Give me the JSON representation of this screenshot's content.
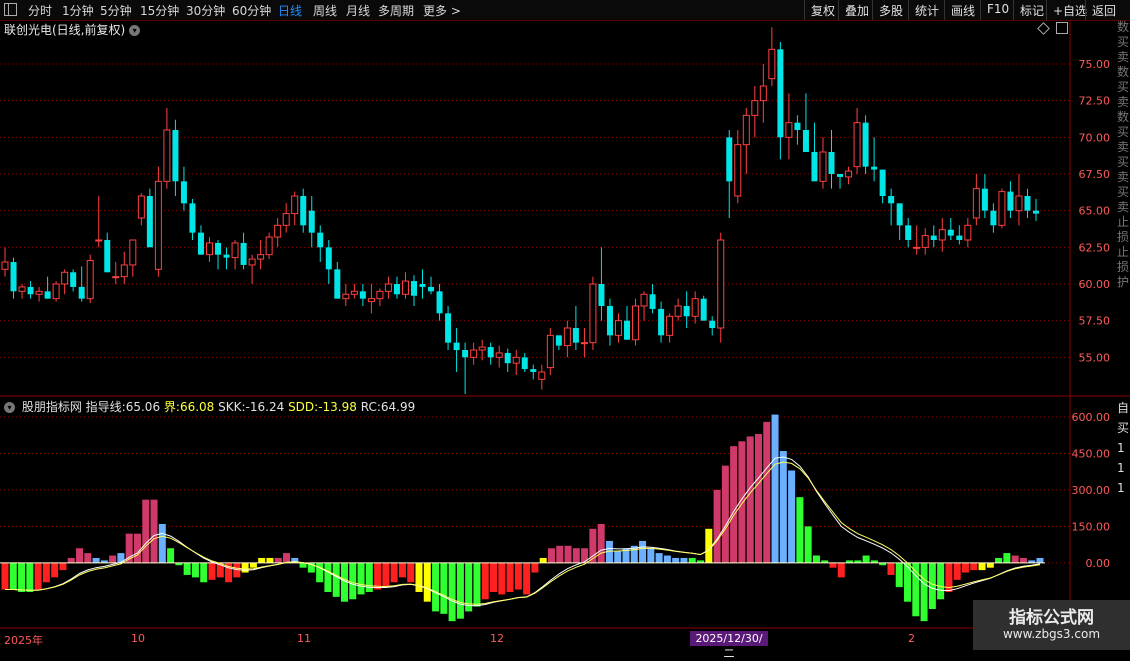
{
  "toolbar": {
    "periods": [
      {
        "label": "分时"
      },
      {
        "label": "1分钟"
      },
      {
        "label": "5分钟"
      },
      {
        "label": "15分钟"
      },
      {
        "label": "30分钟"
      },
      {
        "label": "60分钟"
      },
      {
        "label": "日线",
        "active": true
      },
      {
        "label": "周线"
      },
      {
        "label": "月线"
      },
      {
        "label": "多周期"
      },
      {
        "label": "更多 >"
      }
    ],
    "right": [
      {
        "label": "复权"
      },
      {
        "label": "叠加"
      },
      {
        "label": "多股"
      },
      {
        "label": "统计"
      },
      {
        "label": "画线"
      },
      {
        "label": "F10"
      },
      {
        "label": "标记"
      },
      {
        "label": "+自选"
      },
      {
        "label": "返回"
      }
    ]
  },
  "chart_title": "联创光电(日线,前复权)",
  "indicator": {
    "name": "股朋指标网",
    "guide_label": "指导线:",
    "guide_value": "65.06",
    "bound_label": "界:",
    "bound_value": "66.08",
    "skk_label": "SKK:",
    "skk_value": "-16.24",
    "sdd_label": "SDD:",
    "sdd_value": "-13.98",
    "rc_label": "RC:",
    "rc_value": "64.99"
  },
  "right_strip_top": "数买卖数买卖数买卖买卖买卖止损止损护",
  "right_strip_bottom": "自买111",
  "dates": {
    "labels": [
      {
        "text": "2025年"
      },
      {
        "text": "10"
      },
      {
        "text": "11"
      },
      {
        "text": "12"
      },
      {
        "text": "2"
      }
    ],
    "cursor": "2025/12/30/二"
  },
  "watermark": {
    "line1": "指标公式网",
    "line2": "www.zbgs3.com"
  },
  "colors": {
    "up": "#ff4040",
    "down": "#00e5e5",
    "grid": "#8b0000",
    "axis": "#ff5a5a"
  },
  "chart_data": [
    {
      "type": "candlestick",
      "title": "联创光电(日线,前复权)",
      "y_ticks": [
        55.0,
        57.5,
        60.0,
        62.5,
        65.0,
        67.5,
        70.0,
        72.5,
        75.0
      ],
      "ylim": [
        52.5,
        78
      ],
      "candles": [
        [
          61.0,
          62.5,
          60.5,
          61.5
        ],
        [
          61.5,
          61.8,
          59.0,
          59.5
        ],
        [
          59.5,
          60.0,
          59.0,
          59.8
        ],
        [
          59.8,
          60.2,
          59.0,
          59.3
        ],
        [
          59.3,
          59.8,
          58.8,
          59.5
        ],
        [
          59.5,
          60.5,
          59.0,
          59.0
        ],
        [
          59.0,
          60.2,
          58.8,
          60.0
        ],
        [
          60.0,
          61.0,
          59.3,
          60.8
        ],
        [
          60.8,
          61.0,
          59.5,
          59.8
        ],
        [
          59.8,
          61.2,
          58.8,
          59.0
        ],
        [
          59.0,
          62.0,
          58.7,
          61.6
        ],
        [
          63.0,
          66.0,
          62.5,
          63.0
        ],
        [
          63.0,
          63.5,
          60.8,
          60.8
        ],
        [
          60.5,
          61.5,
          60.0,
          60.5
        ],
        [
          60.5,
          62.2,
          60.0,
          61.3
        ],
        [
          61.3,
          63.0,
          60.5,
          63.0
        ],
        [
          64.5,
          66.2,
          64.0,
          66.0
        ],
        [
          66.0,
          66.5,
          63.0,
          62.5
        ],
        [
          61.0,
          68.0,
          60.5,
          67.0
        ],
        [
          67.0,
          72.0,
          66.5,
          70.5
        ],
        [
          70.5,
          71.2,
          66.0,
          67.0
        ],
        [
          67.0,
          68.0,
          65.0,
          65.5
        ],
        [
          65.5,
          65.8,
          63.0,
          63.5
        ],
        [
          63.5,
          64.0,
          62.0,
          62.0
        ],
        [
          62.0,
          63.2,
          61.5,
          62.8
        ],
        [
          62.8,
          63.0,
          61.0,
          62.0
        ],
        [
          62.0,
          62.5,
          61.0,
          61.8
        ],
        [
          61.8,
          63.0,
          61.0,
          62.8
        ],
        [
          62.8,
          63.5,
          61.0,
          61.3
        ],
        [
          61.3,
          62.0,
          60.0,
          61.7
        ],
        [
          61.7,
          63.0,
          61.0,
          62.0
        ],
        [
          62.0,
          63.5,
          61.7,
          63.2
        ],
        [
          63.2,
          64.5,
          62.5,
          64.0
        ],
        [
          64.0,
          65.5,
          63.5,
          64.8
        ],
        [
          64.8,
          66.3,
          64.0,
          66.0
        ],
        [
          66.0,
          66.5,
          63.5,
          64.0
        ],
        [
          65.0,
          66.0,
          62.5,
          63.5
        ],
        [
          63.5,
          64.0,
          61.5,
          62.5
        ],
        [
          62.5,
          63.0,
          60.0,
          61.0
        ],
        [
          61.0,
          61.5,
          59.0,
          59.0
        ],
        [
          59.0,
          60.0,
          58.5,
          59.3
        ],
        [
          59.3,
          60.0,
          59.0,
          59.5
        ],
        [
          59.5,
          60.0,
          58.5,
          59.0
        ],
        [
          58.8,
          60.0,
          58.0,
          59.0
        ],
        [
          59.0,
          59.7,
          58.5,
          59.5
        ],
        [
          59.5,
          60.5,
          59.0,
          60.0
        ],
        [
          60.0,
          60.5,
          59.0,
          59.3
        ],
        [
          59.3,
          60.8,
          59.0,
          60.2
        ],
        [
          60.2,
          60.6,
          58.5,
          59.2
        ],
        [
          60.0,
          61.0,
          59.0,
          59.8
        ],
        [
          59.8,
          60.5,
          59.3,
          59.5
        ],
        [
          59.5,
          60.0,
          57.5,
          58.0
        ],
        [
          58.0,
          58.5,
          55.5,
          56.0
        ],
        [
          56.0,
          57.0,
          54.0,
          55.5
        ],
        [
          55.5,
          56.0,
          52.5,
          55.0
        ],
        [
          55.0,
          56.0,
          54.5,
          55.5
        ],
        [
          55.5,
          56.2,
          54.8,
          55.7
        ],
        [
          55.7,
          56.0,
          54.5,
          55.0
        ],
        [
          55.0,
          55.8,
          54.3,
          55.3
        ],
        [
          55.3,
          55.6,
          54.0,
          54.6
        ],
        [
          54.6,
          55.5,
          53.8,
          55.0
        ],
        [
          55.0,
          55.3,
          54.0,
          54.2
        ],
        [
          54.2,
          54.5,
          53.5,
          54.0
        ],
        [
          53.5,
          54.5,
          52.8,
          54.0
        ],
        [
          54.3,
          57.0,
          53.8,
          56.5
        ],
        [
          56.5,
          56.5,
          55.5,
          55.8
        ],
        [
          55.8,
          57.5,
          55.0,
          57.0
        ],
        [
          57.0,
          58.5,
          55.5,
          56.0
        ],
        [
          56.0,
          57.0,
          55.0,
          56.0
        ],
        [
          56.0,
          60.5,
          55.5,
          60.0
        ],
        [
          60.0,
          62.5,
          57.5,
          58.5
        ],
        [
          58.5,
          59.0,
          55.8,
          56.5
        ],
        [
          56.5,
          58.0,
          56.0,
          57.5
        ],
        [
          57.5,
          58.5,
          56.2,
          56.2
        ],
        [
          56.2,
          59.0,
          55.8,
          58.5
        ],
        [
          58.5,
          59.5,
          57.5,
          59.3
        ],
        [
          59.3,
          60.0,
          58.0,
          58.3
        ],
        [
          58.3,
          58.8,
          56.0,
          56.5
        ],
        [
          56.5,
          58.0,
          56.0,
          57.8
        ],
        [
          57.8,
          59.0,
          57.5,
          58.5
        ],
        [
          58.5,
          59.5,
          57.0,
          57.8
        ],
        [
          57.8,
          59.5,
          57.3,
          59.0
        ],
        [
          59.0,
          59.2,
          57.5,
          57.5
        ],
        [
          57.5,
          57.8,
          56.5,
          57.0
        ],
        [
          57.0,
          63.5,
          56.0,
          63.0
        ],
        [
          70.0,
          70.5,
          64.5,
          67.0
        ],
        [
          66.0,
          70.5,
          65.5,
          69.5
        ],
        [
          69.5,
          72.0,
          67.5,
          71.5
        ],
        [
          71.5,
          73.5,
          70.0,
          72.5
        ],
        [
          72.5,
          75.0,
          71.0,
          73.5
        ],
        [
          74.0,
          77.5,
          73.5,
          76.0
        ],
        [
          76.0,
          76.5,
          68.5,
          70.0
        ],
        [
          70.0,
          73.0,
          68.5,
          71.0
        ],
        [
          71.0,
          71.5,
          69.5,
          70.5
        ],
        [
          70.5,
          73.0,
          69.0,
          69.0
        ],
        [
          69.0,
          71.0,
          67.5,
          67.0
        ],
        [
          67.0,
          70.0,
          66.5,
          69.0
        ],
        [
          69.0,
          70.5,
          66.5,
          67.5
        ],
        [
          67.5,
          67.5,
          66.5,
          67.3
        ],
        [
          67.3,
          68.0,
          66.8,
          67.7
        ],
        [
          68.0,
          72.0,
          67.5,
          71.0
        ],
        [
          71.0,
          71.5,
          67.5,
          68.0
        ],
        [
          68.0,
          70.0,
          67.0,
          67.8
        ],
        [
          67.8,
          67.5,
          65.5,
          66.0
        ],
        [
          66.0,
          66.5,
          64.0,
          65.5
        ],
        [
          65.5,
          65.5,
          63.0,
          64.0
        ],
        [
          64.0,
          64.5,
          62.5,
          63.0
        ],
        [
          62.5,
          64.0,
          62.0,
          62.5
        ],
        [
          62.5,
          63.8,
          62.0,
          63.3
        ],
        [
          63.3,
          64.0,
          62.5,
          63.0
        ],
        [
          63.0,
          64.5,
          62.2,
          63.7
        ],
        [
          63.7,
          64.5,
          63.0,
          63.3
        ],
        [
          63.3,
          64.0,
          62.7,
          63.0
        ],
        [
          63.0,
          64.5,
          62.5,
          64.0
        ],
        [
          64.5,
          67.5,
          64.0,
          66.5
        ],
        [
          66.5,
          67.5,
          64.5,
          65.0
        ],
        [
          65.0,
          65.5,
          63.5,
          64.0
        ],
        [
          64.0,
          66.5,
          63.8,
          66.3
        ],
        [
          66.3,
          67.0,
          64.5,
          65.0
        ],
        [
          65.0,
          67.5,
          64.0,
          66.0
        ],
        [
          66.0,
          66.5,
          64.5,
          65.0
        ],
        [
          65.0,
          65.8,
          64.3,
          64.8
        ]
      ]
    },
    {
      "type": "bar",
      "title": "股朋指标网",
      "y_ticks": [
        0.0,
        150.0,
        300.0,
        450.0,
        600.0
      ],
      "ylim": [
        -260,
        670
      ],
      "values": [
        -110,
        -110,
        -120,
        -120,
        -110,
        -80,
        -60,
        -30,
        20,
        60,
        40,
        20,
        10,
        30,
        40,
        120,
        120,
        260,
        260,
        160,
        60,
        -10,
        -50,
        -60,
        -80,
        -70,
        -60,
        -80,
        -60,
        -40,
        -20,
        20,
        20,
        20,
        40,
        20,
        -20,
        -40,
        -80,
        -120,
        -140,
        -160,
        -150,
        -130,
        -120,
        -110,
        -100,
        -80,
        -60,
        -80,
        -120,
        -160,
        -200,
        -210,
        -240,
        -230,
        -200,
        -180,
        -150,
        -120,
        -130,
        -120,
        -110,
        -130,
        -40,
        20,
        60,
        70,
        70,
        60,
        60,
        140,
        160,
        90,
        50,
        60,
        70,
        90,
        60,
        40,
        30,
        20,
        20,
        20,
        10,
        140,
        300,
        400,
        480,
        500,
        520,
        530,
        580,
        610,
        460,
        380,
        270,
        150,
        30,
        10,
        -20,
        -60,
        10,
        10,
        30,
        10,
        -10,
        -50,
        -100,
        -160,
        -220,
        -240,
        -190,
        -150,
        -120,
        -70,
        -40,
        -30,
        -30,
        -20,
        20,
        40,
        30,
        20,
        10,
        20
      ],
      "bar_colors": [
        "r",
        "g",
        "g",
        "g",
        "r",
        "r",
        "r",
        "r",
        "r",
        "r",
        "r",
        "b",
        "b",
        "r",
        "b",
        "r",
        "r",
        "r",
        "r",
        "b",
        "g",
        "g",
        "g",
        "g",
        "g",
        "r",
        "r",
        "r",
        "r",
        "y",
        "y",
        "y",
        "y",
        "r",
        "r",
        "b",
        "g",
        "g",
        "g",
        "g",
        "g",
        "g",
        "g",
        "g",
        "g",
        "r",
        "r",
        "r",
        "r",
        "r",
        "y",
        "y",
        "g",
        "g",
        "g",
        "g",
        "g",
        "g",
        "r",
        "r",
        "r",
        "r",
        "r",
        "r",
        "r",
        "y",
        "r",
        "r",
        "r",
        "r",
        "r",
        "r",
        "r",
        "b",
        "b",
        "b",
        "b",
        "b",
        "b",
        "b",
        "b",
        "b",
        "b",
        "g",
        "g",
        "y",
        "r",
        "r",
        "r",
        "r",
        "r",
        "r",
        "r",
        "b",
        "b",
        "b",
        "g",
        "g",
        "g",
        "g",
        "r",
        "r",
        "g",
        "g",
        "g",
        "g",
        "g",
        "r",
        "g",
        "g",
        "g",
        "g",
        "g",
        "g",
        "r",
        "r",
        "r",
        "r",
        "y",
        "y",
        "g",
        "g",
        "r",
        "r",
        "b",
        "b",
        "b",
        "g"
      ],
      "series": [
        {
          "name": "指导线"
        },
        {
          "name": "界"
        }
      ]
    }
  ]
}
